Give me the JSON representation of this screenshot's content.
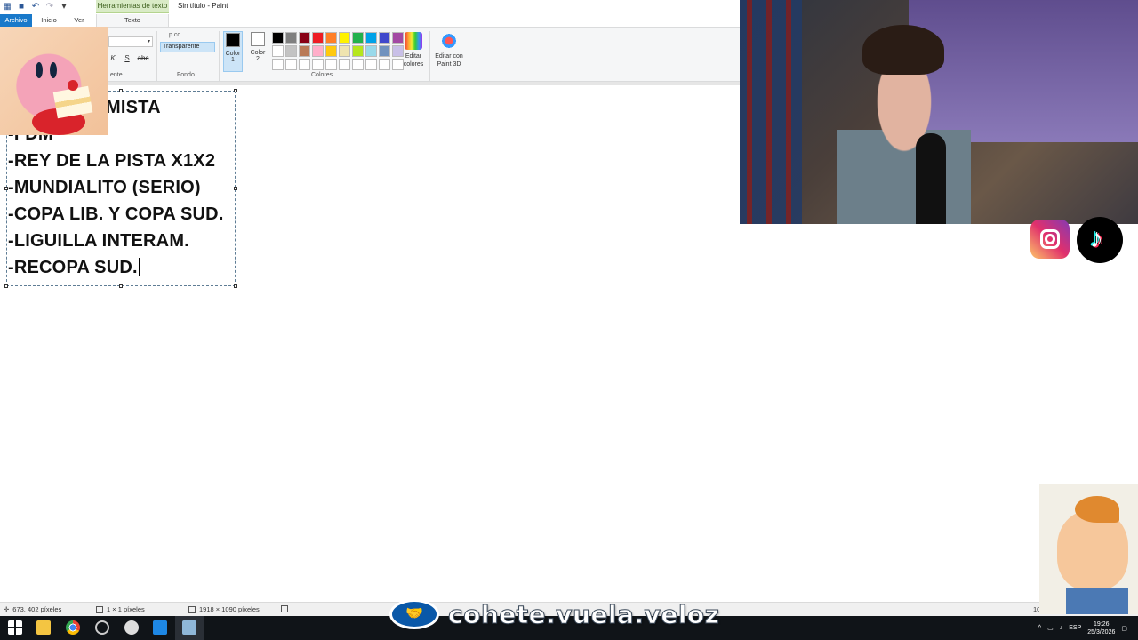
{
  "window": {
    "title": "Sin título - Paint",
    "contextual_tab_group": "Herramientas de texto"
  },
  "tabs": {
    "file": "Archivo",
    "home": "Inicio",
    "view": "Ver",
    "text": "Texto"
  },
  "ribbon": {
    "font_group_label": "Fuente",
    "font_group_label_visible": "ente",
    "format_buttons": [
      "K",
      "S",
      "abc"
    ],
    "background_group_label": "Fondo",
    "opaque_label": "p  co",
    "transparent_label": "Transparente",
    "color1_label": "Color",
    "color1_num": "1",
    "color2_label": "Color",
    "color2_num": "2",
    "colors_group_label": "Colores",
    "edit_colors_line1": "Editar",
    "edit_colors_line2": "colores",
    "paint3d_line1": "Editar con",
    "paint3d_line2": "Paint 3D",
    "palette": [
      "#000000",
      "#7f7f7f",
      "#880015",
      "#ed1c24",
      "#ff7f27",
      "#fff200",
      "#22b14c",
      "#00a2e8",
      "#3f48cc",
      "#a349a4",
      "#ffffff",
      "#c3c3c3",
      "#b97a57",
      "#ffaec9",
      "#ffc90e",
      "#efe4b0",
      "#b5e61d",
      "#99d9ea",
      "#7092be",
      "#c8bfe7",
      "#ffffff",
      "#ffffff",
      "#ffffff",
      "#ffffff",
      "#ffffff",
      "#ffffff",
      "#ffffff",
      "#ffffff",
      "#ffffff",
      "#ffffff"
    ]
  },
  "canvas": {
    "lines": [
      "MISTA",
      "-FDM",
      "-REY DE LA PISTA X1X2",
      "-MUNDIALITO (SERIO)",
      "-COPA LIB. Y COPA SUD.",
      "-LIGUILLA INTERAM.",
      "-RECOPA SUD."
    ]
  },
  "statusbar": {
    "cursor_pos": "673, 402 píxeles",
    "selection_size": "1 × 1 píxeles",
    "image_size": "1918 × 1090 píxeles",
    "zoom_partial": "10"
  },
  "taskbar": {
    "language": "ESP",
    "time": "19:26",
    "date": "25/3/2026"
  },
  "overlay": {
    "handle": "cohete.vuela.veloz"
  }
}
